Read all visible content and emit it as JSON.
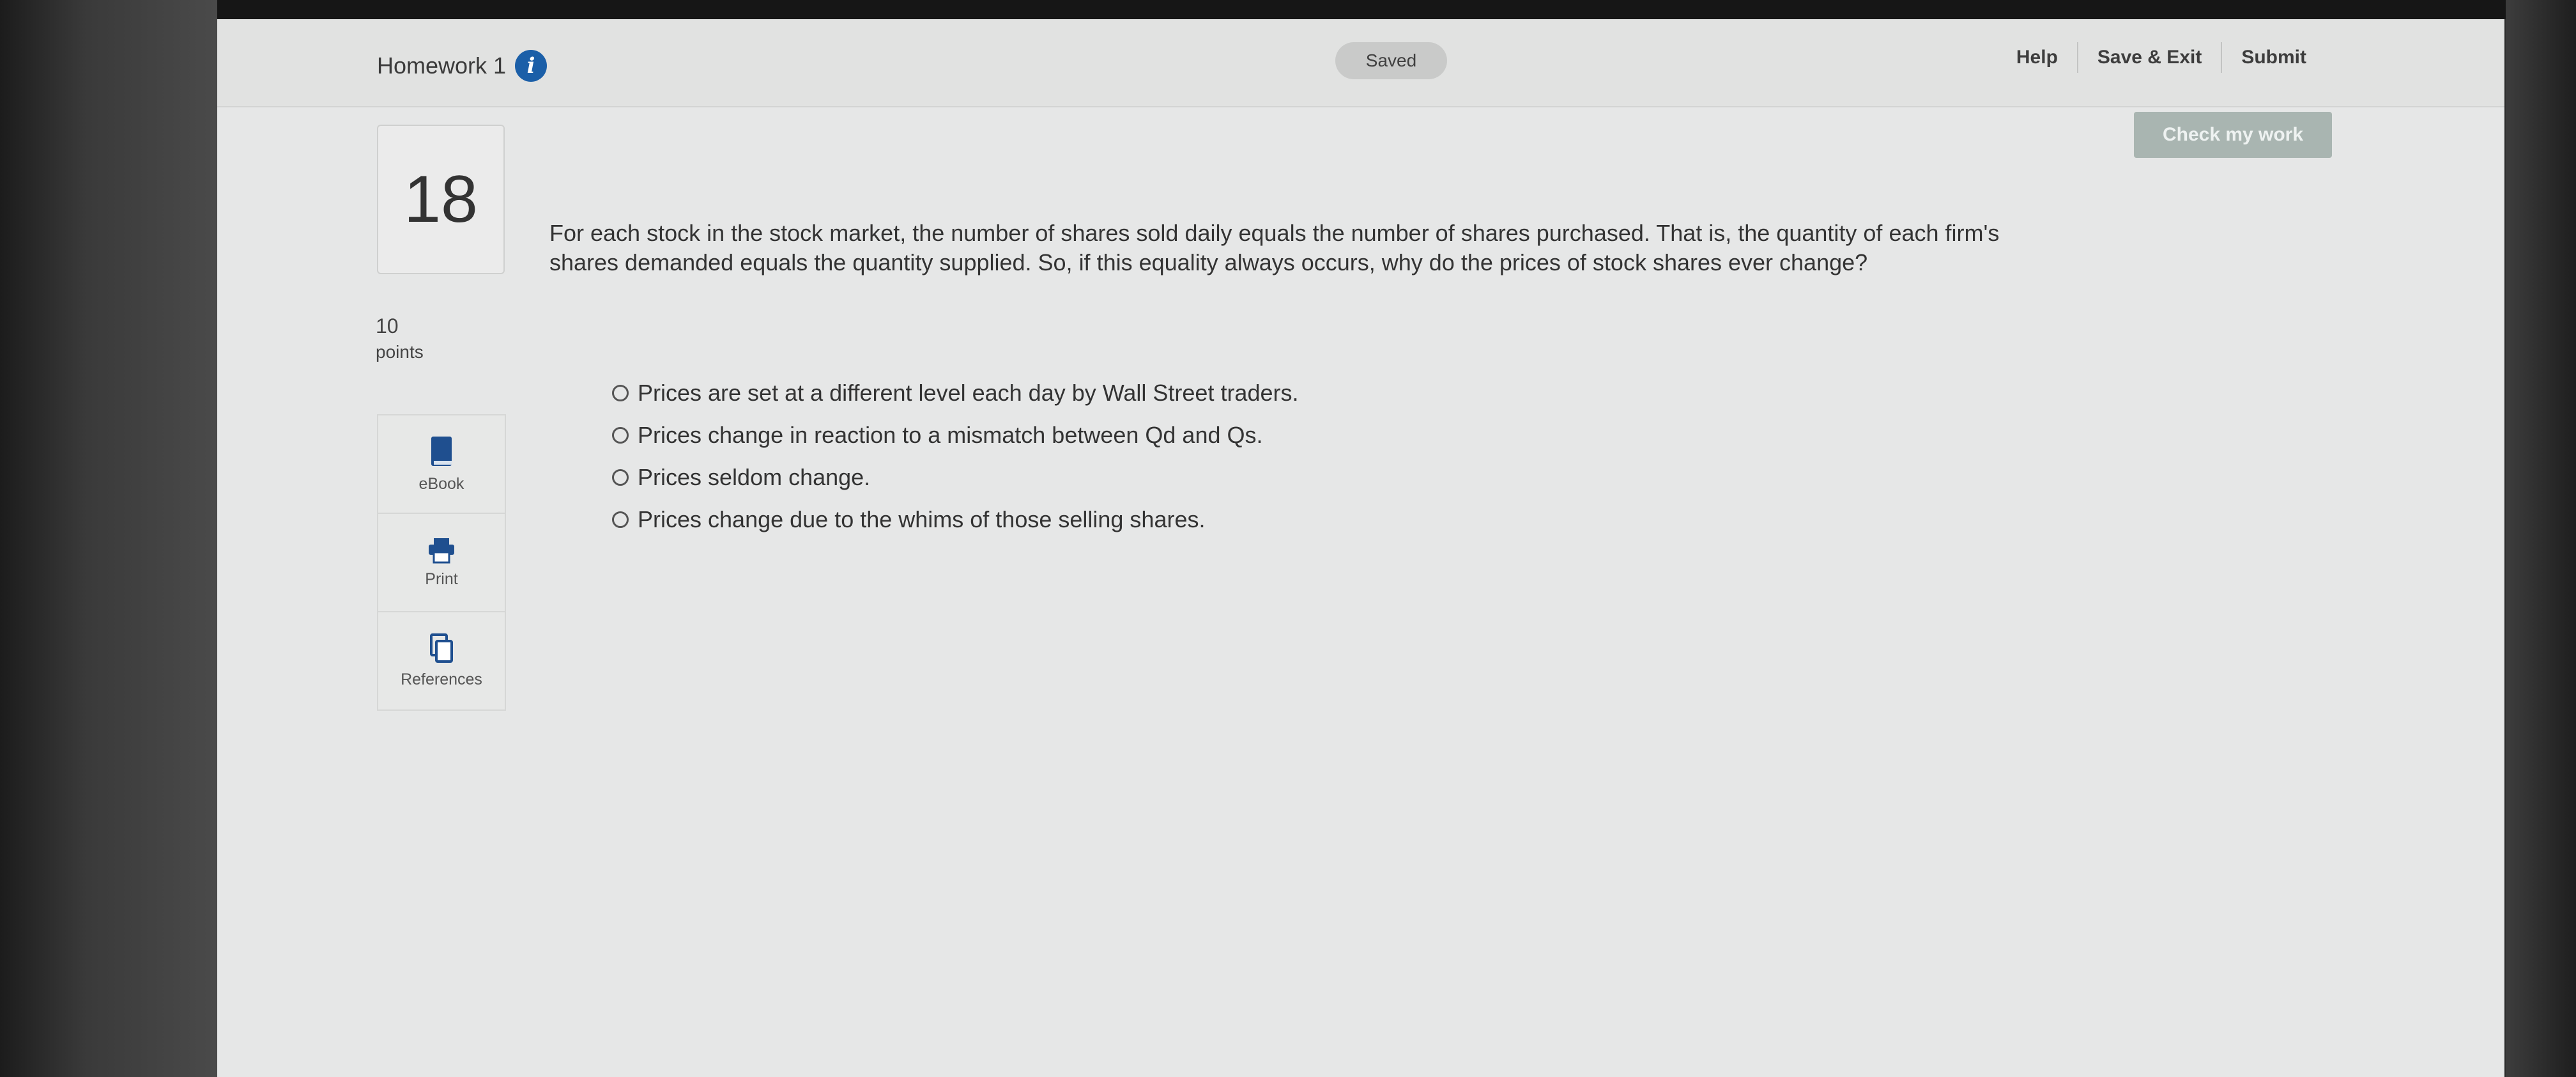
{
  "header": {
    "assignment_title": "Homework 1",
    "saved_label": "Saved",
    "links": {
      "help": "Help",
      "save_exit": "Save & Exit",
      "submit": "Submit"
    }
  },
  "actions": {
    "check_label": "Check my work"
  },
  "question": {
    "number": "18",
    "points_value": "10",
    "points_label": "points",
    "text": "For each stock in the stock market, the number of shares sold daily equals the number of shares purchased. That is, the quantity of each firm's shares demanded equals the quantity supplied. So, if this equality always occurs, why do the prices of stock shares ever change?",
    "options": [
      "Prices are set at a different level each day by Wall Street traders.",
      "Prices change in reaction to a mismatch between Qd and Qs.",
      "Prices seldom change.",
      "Prices change due to the whims of those selling shares."
    ]
  },
  "sidebar": {
    "ebook": "eBook",
    "print": "Print",
    "references": "References"
  },
  "colors": {
    "info_icon": "#1b5fa8",
    "check_button": "#a9b5b1",
    "ebook_icon": "#1f4f8f"
  }
}
